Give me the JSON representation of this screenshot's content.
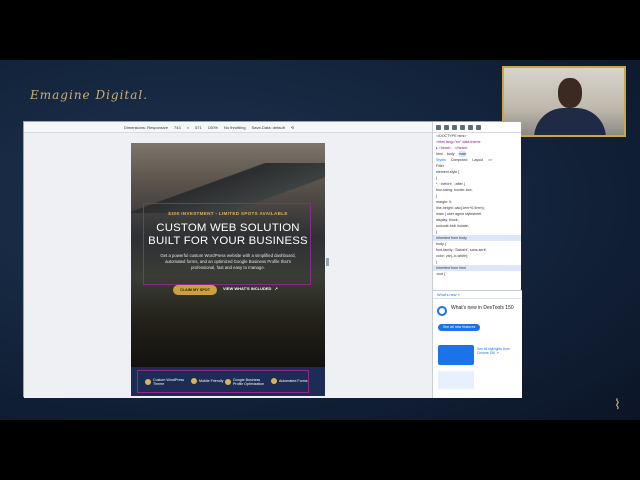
{
  "brand": {
    "logo_text": "Emagine Digital."
  },
  "devtools_bar": {
    "dimensions_label": "Dimensions: Responsive",
    "width": "743",
    "height": "571",
    "zoom": "100%",
    "throttle": "No throttling",
    "save_data": "Save-Data: default"
  },
  "hero": {
    "kicker": "$300 INVESTMENT - LIMITED SPOTS AVAILABLE",
    "headline_line1": "CUSTOM WEB SOLUTION",
    "headline_line2": "BUILT FOR YOUR BUSINESS",
    "subtext": "Get a powerful custom WordPress website with a simplified dashboard, automated forms, and an optimized Google Business Profile that's professional, fast and easy to manage.",
    "cta_primary": "CLAIM MY SPOT",
    "cta_secondary": "VIEW WHAT'S INCLUDED",
    "cta_secondary_arrow": "↗"
  },
  "features": [
    {
      "label_line1": "Custom WordPress",
      "label_line2": "Theme"
    },
    {
      "label_line1": "Mobile Friendly",
      "label_line2": ""
    },
    {
      "label_line1": "Google Business",
      "label_line2": "Profile Optimization"
    },
    {
      "label_line1": "Automated Forms",
      "label_line2": ""
    }
  ],
  "devtools_panel": {
    "tabs": [
      "html",
      "body",
      "main"
    ],
    "subtabs": [
      "Styles",
      "Computed",
      "Layout",
      ">>"
    ],
    "filter_placeholder": "Filter",
    "code_lines": [
      "<!DOCTYPE html>",
      "<html lang=\"en\" data-theme",
      "▸ <head>…</head>",
      "element.style {",
      "}",
      "*, ::before, ::after {",
      "  box-sizing: border-box;",
      "}",
      "margin: 0;",
      "line-height: calc(1em+0.5rem);",
      "main {  user agent stylesheet",
      "  display: block;",
      "  unicode-bidi: isolate;",
      "}",
      "Inherited from body",
      "body {",
      "  font-family: 'Satoshi', sans-serif;",
      "  color: var(--b-white);",
      "}",
      "Inherited from html",
      ":root {"
    ],
    "whats_new_tab": "What's new ×",
    "whats_new_title": "What's new in DevTools 150",
    "whats_new_button": "See all new features",
    "whats_new_card_text": "See all highlights from Chrome 150 ↗"
  },
  "colors": {
    "accent_gold": "#c9a23e",
    "border_magenta": "#8c2a88",
    "strip_navy": "#1c2c55"
  }
}
